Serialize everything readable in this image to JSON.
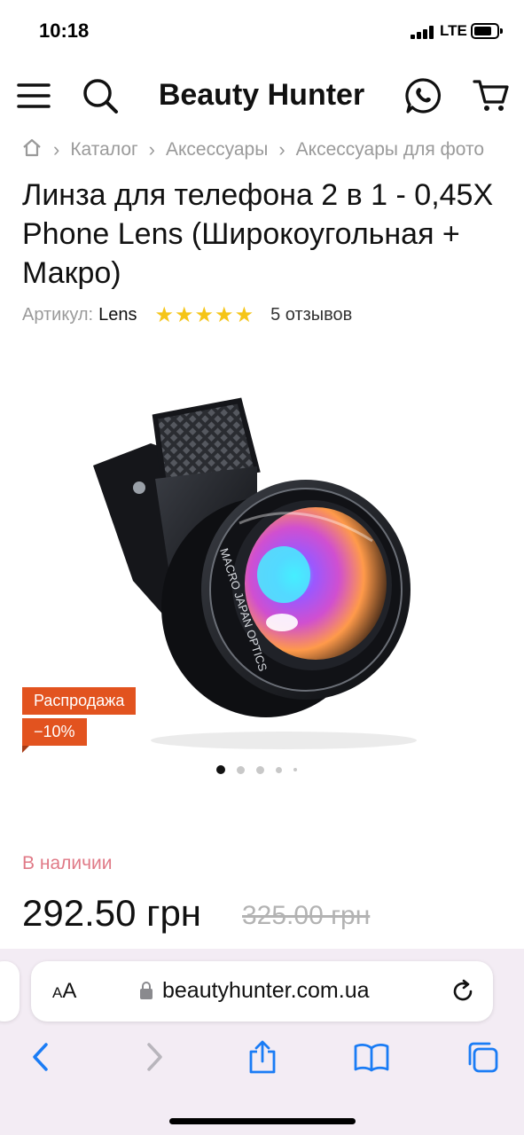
{
  "status_bar": {
    "time": "10:18",
    "network": "LTE",
    "icons": [
      "signal-icon",
      "battery-icon"
    ]
  },
  "header": {
    "title": "Beauty Hunter",
    "icons": [
      "menu-icon",
      "search-icon",
      "chat-icon",
      "cart-icon"
    ]
  },
  "breadcrumb": {
    "items": [
      "Каталог",
      "Аксессуары",
      "Аксессуары для фото"
    ],
    "home_icon": "home-icon"
  },
  "product": {
    "title": "Линза для телефона 2 в 1 - 0,45X Phone Lens (Широкоугольная + Макро)",
    "sku_label": "Артикул:",
    "sku_value": "Lens",
    "stars": "★★★★★",
    "rating": 5,
    "reviews": "5 отзывов",
    "sale_badge": "Распродажа",
    "discount_badge": "−10%",
    "gallery_count": 5,
    "gallery_active": 1,
    "availability": "В наличии",
    "price": "292.50 грн",
    "old_price": "325.00 грн"
  },
  "colors": {
    "sale": "#e2531f",
    "stars": "#f5c518",
    "availability": "#e07a87",
    "browser_bg": "#f3ecf4",
    "safari_blue": "#1a7cf5"
  },
  "browser": {
    "text_size_label": "AA",
    "url": "beautyhunter.com.ua",
    "toolbar": [
      "back-icon",
      "forward-icon",
      "share-icon",
      "bookmarks-icon",
      "tabs-icon"
    ]
  }
}
